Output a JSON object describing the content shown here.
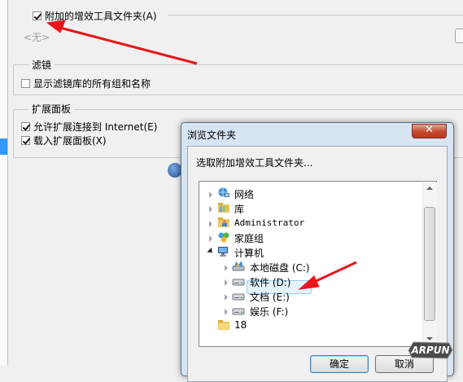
{
  "addins": {
    "checkbox_label": "附加的增效工具文件夹(A)",
    "checked": true,
    "path_placeholder": "<无>"
  },
  "filters": {
    "title": "滤镜",
    "show_all_label": "显示滤镜库的所有组和名称",
    "show_all_checked": false
  },
  "extensions": {
    "title": "扩展面板",
    "allow_internet_label": "允许扩展连接到 Internet(E)",
    "allow_internet_checked": true,
    "load_panels_label": "载入扩展面板(X)",
    "load_panels_checked": true
  },
  "dialog": {
    "title": "浏览文件夹",
    "close_glyph": "✕",
    "prompt": "选取附加增效工具文件夹...",
    "tree": [
      {
        "label": "网络",
        "icon": "network-icon",
        "expander": "collapsed",
        "level": 0
      },
      {
        "label": "库",
        "icon": "library-icon",
        "expander": "collapsed",
        "level": 0
      },
      {
        "label": "Administrator",
        "icon": "user-folder-icon",
        "expander": "collapsed",
        "level": 0
      },
      {
        "label": "家庭组",
        "icon": "homegroup-icon",
        "expander": "collapsed",
        "level": 0
      },
      {
        "label": "计算机",
        "icon": "computer-icon",
        "expander": "expanded",
        "level": 0
      },
      {
        "label": "本地磁盘 (C:)",
        "icon": "system-drive-icon",
        "expander": "collapsed",
        "level": 1
      },
      {
        "label": "软件 (D:)",
        "icon": "drive-icon",
        "expander": "collapsed",
        "level": 1
      },
      {
        "label": "文档 (E:)",
        "icon": "drive-icon",
        "expander": "collapsed",
        "level": 1,
        "selected": true
      },
      {
        "label": "娱乐 (F:)",
        "icon": "drive-icon",
        "expander": "collapsed",
        "level": 1
      },
      {
        "label": "18",
        "icon": "folder-icon",
        "expander": "none",
        "level": 0
      }
    ],
    "ok_label": "确定",
    "cancel_label": "取消"
  },
  "watermark": "ARPUN",
  "colors": {
    "arrow": "#e8161b",
    "selection": "#3399ff",
    "close_button": "#c4482f",
    "dialog_frame": "#d7e4f2"
  }
}
